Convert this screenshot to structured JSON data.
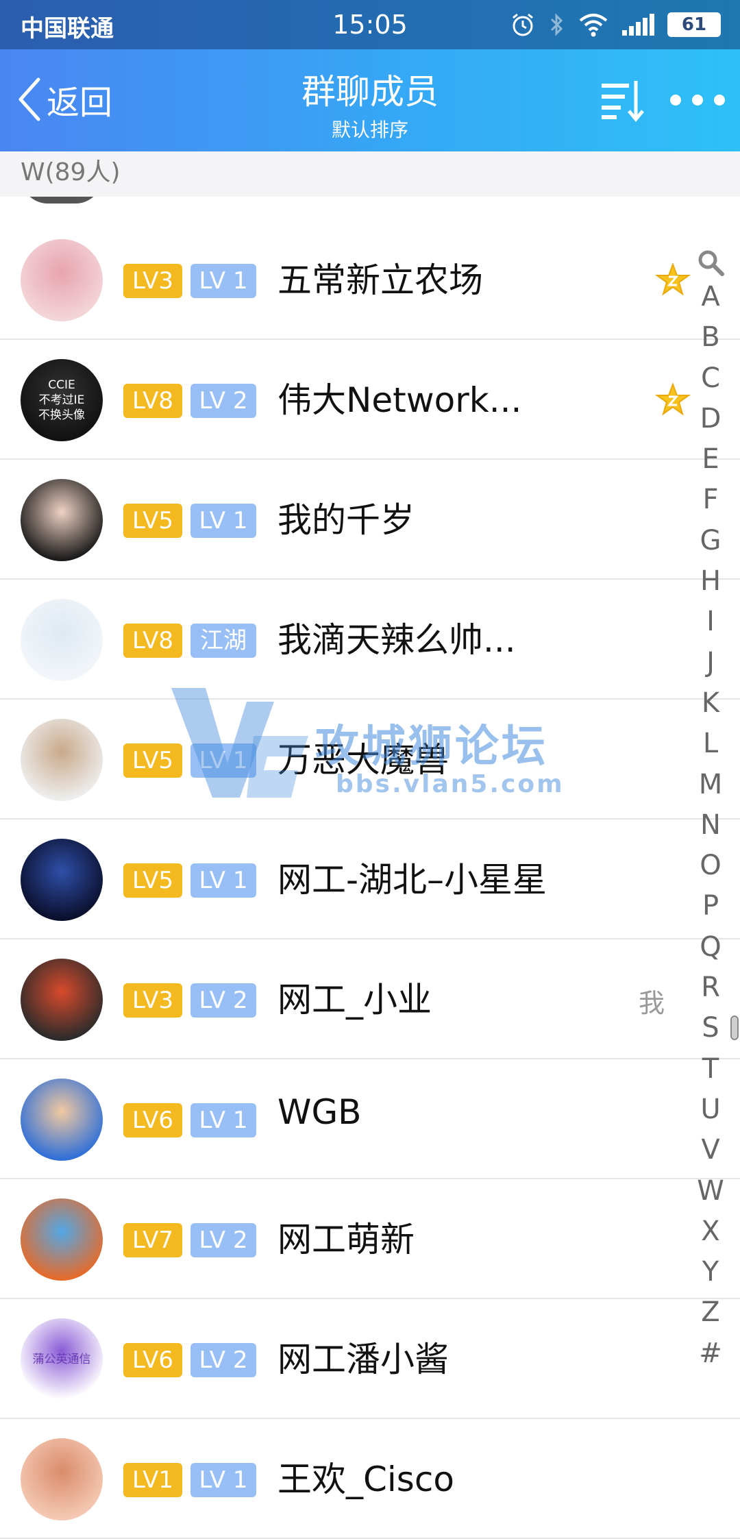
{
  "status_bar": {
    "carrier": "中国联通",
    "time": "15:05",
    "battery": "61"
  },
  "nav": {
    "back_label": "返回",
    "title": "群聊成员",
    "subtitle": "默认排序"
  },
  "section_header": "W(89人)",
  "members": [
    {
      "level": "LV3",
      "rank": "LV 1",
      "name": "五常新立农场",
      "mark": "star",
      "avatar_colors": [
        "#f3d6d9",
        "#e8a3b0"
      ]
    },
    {
      "level": "LV8",
      "rank": "LV 2",
      "name": "伟大Network...",
      "mark": "star",
      "avatar_colors": [
        "#111111",
        "#333333"
      ],
      "avatar_text": [
        "CCIE",
        "不考过IE",
        "不换头像"
      ]
    },
    {
      "level": "LV5",
      "rank": "LV 1",
      "name": "我的千岁",
      "mark": "",
      "avatar_colors": [
        "#1a1a1a",
        "#f0d2c4"
      ]
    },
    {
      "level": "LV8",
      "rank": "江湖传说",
      "name": "我滴天辣么帅...",
      "mark": "",
      "avatar_colors": [
        "#f2f6fa",
        "#dfe9f2"
      ]
    },
    {
      "level": "LV5",
      "rank": "LV 1",
      "name": "万恶大魔兽",
      "mark": "",
      "avatar_colors": [
        "#eeeeee",
        "#c9a98a"
      ]
    },
    {
      "level": "LV5",
      "rank": "LV 1",
      "name": "网工-湖北–小星星",
      "mark": "",
      "avatar_colors": [
        "#0a0f2c",
        "#2f4fa8"
      ]
    },
    {
      "level": "LV3",
      "rank": "LV 2",
      "name": "网工_小业",
      "mark": "me",
      "me_label": "我",
      "avatar_colors": [
        "#2b2b2b",
        "#d94a2c"
      ]
    },
    {
      "level": "LV6",
      "rank": "LV 1",
      "name": "WGB",
      "mark": "",
      "avatar_colors": [
        "#2f6fd8",
        "#f2c9a0"
      ]
    },
    {
      "level": "LV7",
      "rank": "LV 2",
      "name": "网工萌新",
      "mark": "",
      "avatar_colors": [
        "#e66a2a",
        "#52a8e6"
      ]
    },
    {
      "level": "LV6",
      "rank": "LV 2",
      "name": "网工潘小酱",
      "mark": "",
      "avatar_colors": [
        "#ffffff",
        "#8a5bd6"
      ],
      "avatar_text": [
        "蒲公英通信"
      ]
    },
    {
      "level": "LV1",
      "rank": "LV 1",
      "name": "王欢_Cisco",
      "mark": "",
      "avatar_colors": [
        "#f5c9b4",
        "#d98c6a"
      ]
    }
  ],
  "alphabet_index": [
    "A",
    "B",
    "C",
    "D",
    "E",
    "F",
    "G",
    "H",
    "I",
    "J",
    "K",
    "L",
    "M",
    "N",
    "O",
    "P",
    "Q",
    "R",
    "S",
    "T",
    "U",
    "V",
    "W",
    "X",
    "Y",
    "Z",
    "#"
  ],
  "watermark": {
    "title": "攻城狮论坛",
    "url": "bbs.vlan5.com"
  },
  "colors": {
    "level_badge": "#f5b920",
    "rank_badge": "#98bff5",
    "legend_badge": "#f4898a",
    "header_gradient_start": "#4a86f1",
    "header_gradient_end": "#2ec0f7"
  }
}
